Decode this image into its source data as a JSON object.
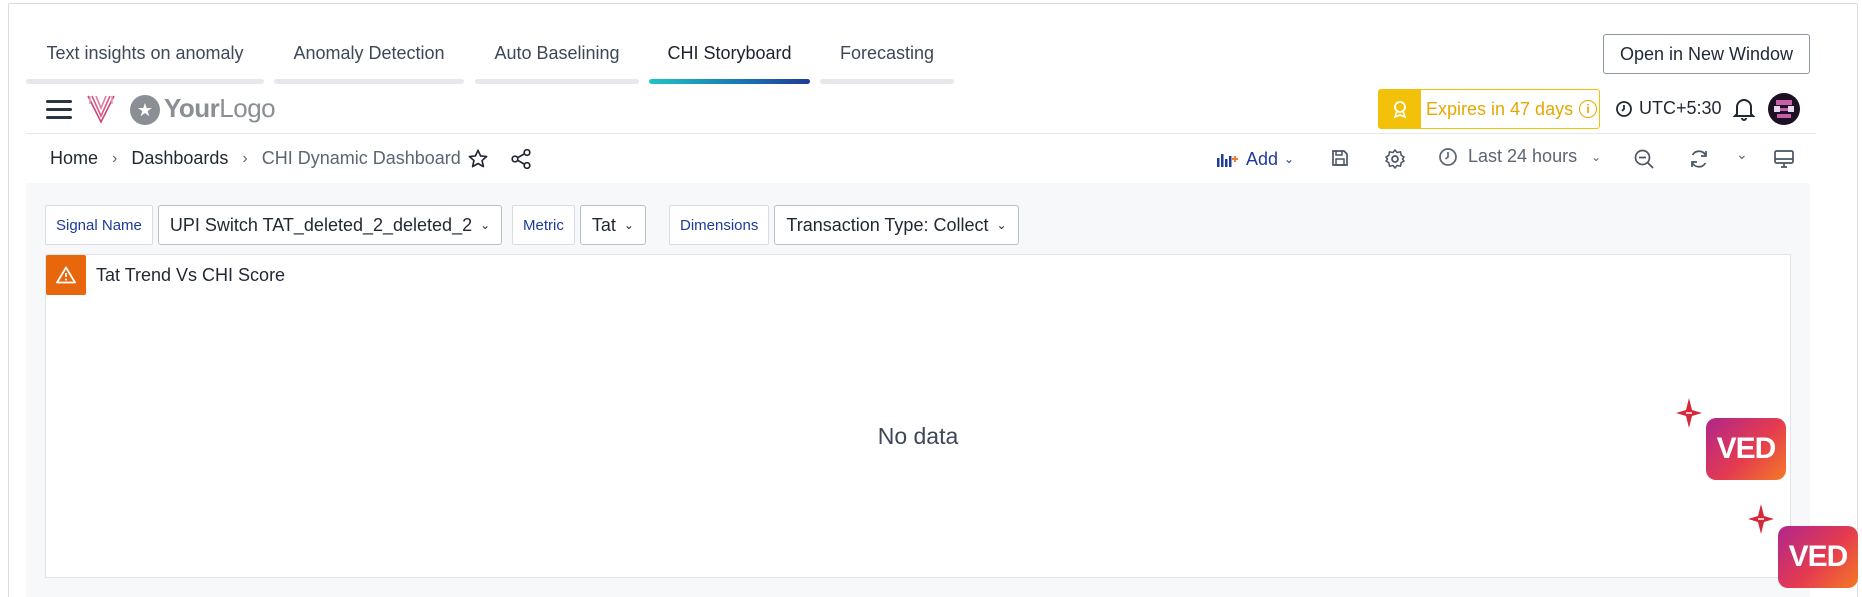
{
  "tabs": [
    {
      "label": "Text insights on anomaly",
      "active": false
    },
    {
      "label": "Anomaly Detection",
      "active": false
    },
    {
      "label": "Auto Baselining",
      "active": false
    },
    {
      "label": "CHI Storyboard",
      "active": true
    },
    {
      "label": "Forecasting",
      "active": false
    }
  ],
  "open_new_window": "Open in New Window",
  "header": {
    "logo_text_bold": "Your",
    "logo_text": "Logo",
    "expires": "Expires in 47 days",
    "timezone": "UTC+5:30"
  },
  "breadcrumb": {
    "home": "Home",
    "dashboards": "Dashboards",
    "current": "CHI Dynamic Dashboard"
  },
  "toolbar": {
    "add_label": "Add",
    "time_range": "Last 24 hours"
  },
  "filters": {
    "signal_label": "Signal Name",
    "signal_value": "UPI Switch TAT_deleted_2_deleted_2",
    "metric_label": "Metric",
    "metric_value": "Tat",
    "dimensions_label": "Dimensions",
    "dimensions_value": "Transaction Type: Collect"
  },
  "panel": {
    "title": "Tat Trend Vs CHI Score",
    "empty_message": "No data"
  },
  "assistant_badge": "VED",
  "colors": {
    "accent": "#1e3b9a",
    "warning": "#e8660c",
    "expires": "#f4c10a"
  }
}
